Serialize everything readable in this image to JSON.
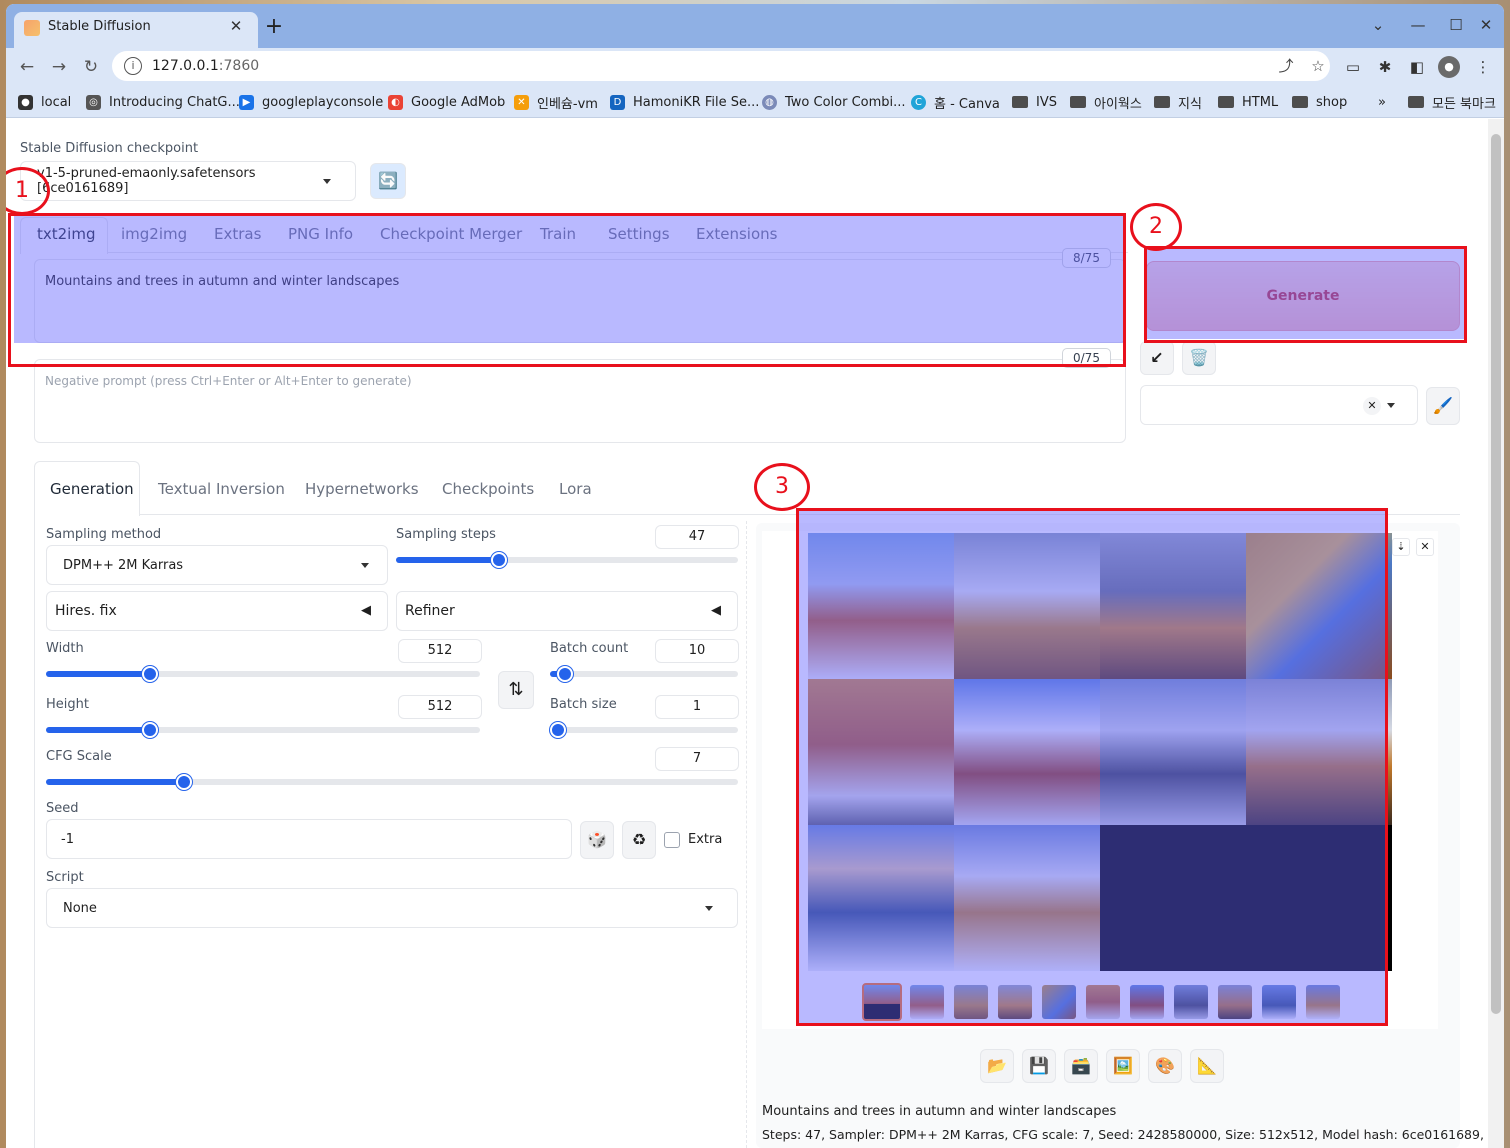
{
  "browser": {
    "tab_title": "Stable Diffusion",
    "url_host": "127.0.0.1",
    "url_port": ":7860",
    "bookmarks": [
      "local",
      "Introducing ChatG...",
      "googleplayconsole",
      "Google AdMob",
      "인베슘-vm",
      "HamoniKR File Se...",
      "Two Color Combi...",
      "홈 - Canva",
      "IVS",
      "아이웍스",
      "지식",
      "HTML",
      "shop"
    ],
    "all_bookmarks": "모든 북마크",
    "more_bookmarks": "»"
  },
  "checkpoint": {
    "label": "Stable Diffusion checkpoint",
    "value": "v1-5-pruned-emaonly.safetensors [6ce0161689]"
  },
  "main_tabs": [
    "txt2img",
    "img2img",
    "Extras",
    "PNG Info",
    "Checkpoint Merger",
    "Train",
    "Settings",
    "Extensions"
  ],
  "prompt": {
    "text": "Mountains and trees in autumn and winter landscapes",
    "counter": "8/75",
    "negative_placeholder": "Negative prompt (press Ctrl+Enter or Alt+Enter to generate)",
    "negative_counter": "0/75"
  },
  "generate": {
    "label": "Generate"
  },
  "sub_tabs": [
    "Generation",
    "Textual Inversion",
    "Hypernetworks",
    "Checkpoints",
    "Lora"
  ],
  "params": {
    "sampling_method_label": "Sampling method",
    "sampling_method": "DPM++ 2M Karras",
    "sampling_steps_label": "Sampling steps",
    "sampling_steps": "47",
    "hires_fix": "Hires. fix",
    "refiner": "Refiner",
    "width_label": "Width",
    "width": "512",
    "height_label": "Height",
    "height": "512",
    "batch_count_label": "Batch count",
    "batch_count": "10",
    "batch_size_label": "Batch size",
    "batch_size": "1",
    "cfg_label": "CFG Scale",
    "cfg": "7",
    "seed_label": "Seed",
    "seed": "-1",
    "extra_label": "Extra",
    "script_label": "Script",
    "script": "None"
  },
  "slider_levels": {
    "sampling_steps": 0.3,
    "width": 0.24,
    "height": 0.24,
    "batch_count": 0.08,
    "batch_size": 0.0,
    "cfg": 0.2
  },
  "annotations": [
    "1",
    "2",
    "3"
  ],
  "output": {
    "caption": "Mountains and trees in autumn and winter landscapes",
    "info": "Steps: 47, Sampler: DPM++ 2M Karras, CFG scale: 7, Seed: 2428580000, Size: 512x512, Model hash: 6ce0161689,"
  },
  "icons": {
    "refresh": "refresh-icon",
    "paste": "arrow-down-left-icon",
    "trash": "trash-icon",
    "brush": "brush-icon",
    "dice": "dice-icon",
    "recycle": "recycle-icon",
    "swap": "swap-icon",
    "folder": "folder-icon",
    "save": "save-icon",
    "zip": "zip-icon",
    "img2img": "image-icon",
    "inpaint": "palette-icon",
    "extras": "ruler-icon"
  },
  "colors": {
    "accent": "#2563eb",
    "annotation_red": "#e8101c",
    "highlight": "#6464ff",
    "generate_text": "#c2303f"
  }
}
